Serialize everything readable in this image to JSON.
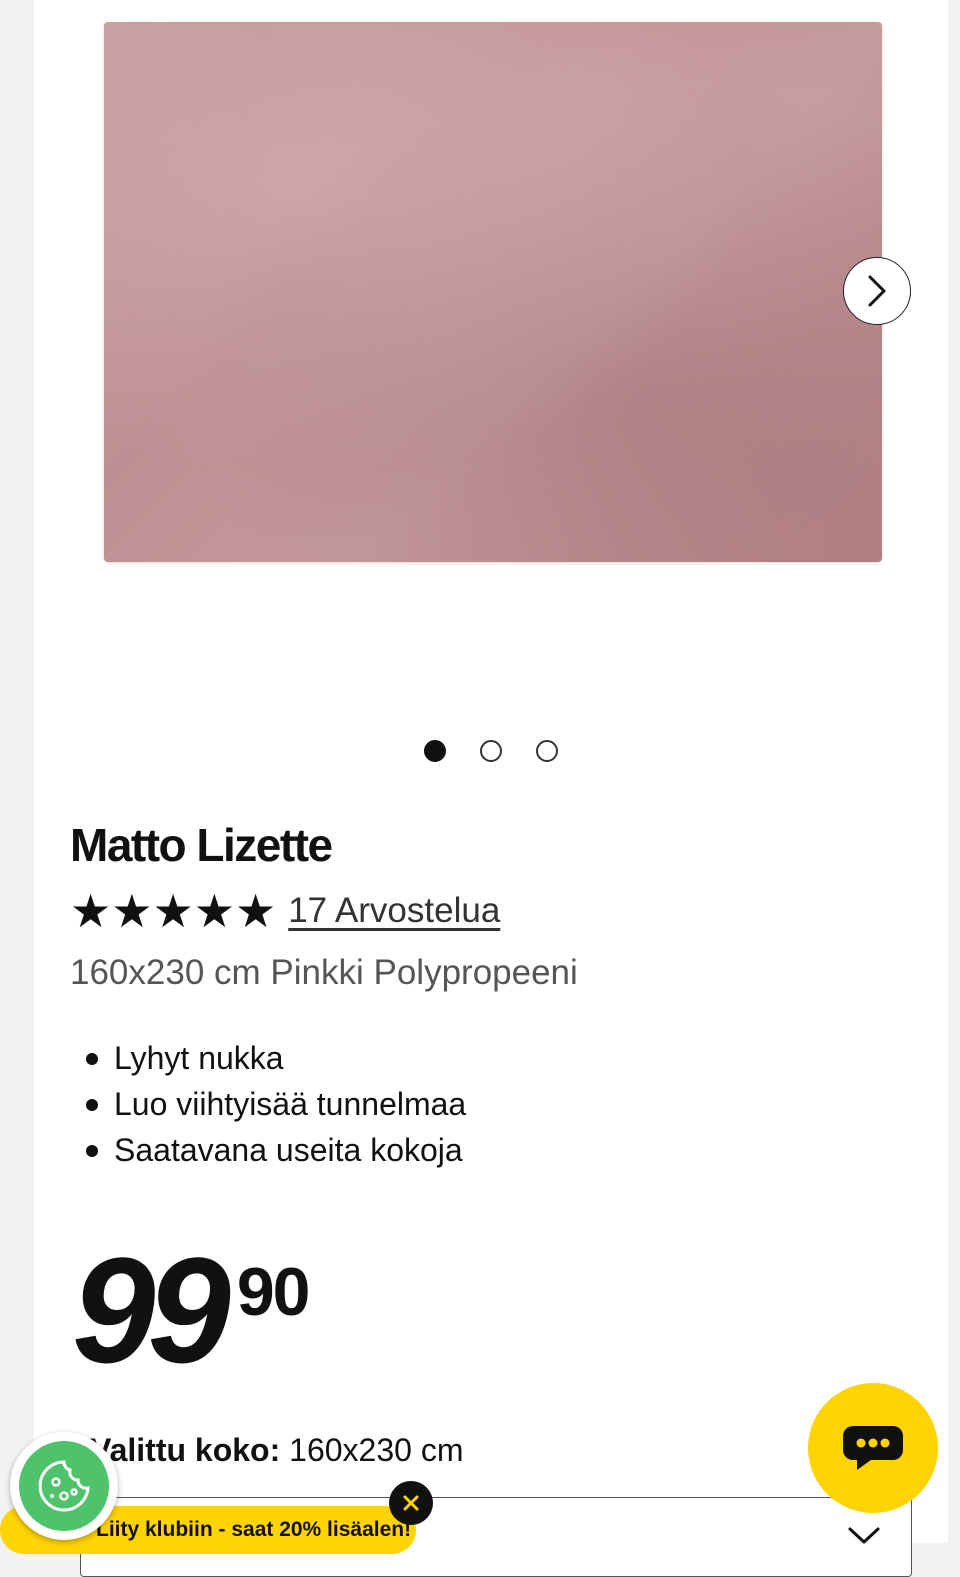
{
  "product": {
    "title": "Matto Lizette",
    "stars": "★★★★★",
    "reviews_link": "17 Arvostelua",
    "subtitle": "160x230 cm Pinkki Polypropeeni",
    "features": [
      "Lyhyt nukka",
      "Luo viihtyisää tunnelmaa",
      "Saatavana useita kokoja"
    ],
    "price_integer": "99",
    "price_decimal": "90",
    "size_label": "Valittu koko:",
    "size_value": "160x230 cm",
    "rating_value": 5,
    "rating_max": 5
  },
  "gallery": {
    "image_count": 3,
    "active_index": 0,
    "image_color": "#c1949a"
  },
  "overlays": {
    "club_banner_text": "Liity klubiin - saat 20% lisäalen!",
    "accent_color": "#ffd400",
    "cookie_color": "#4fc36b"
  },
  "icons": {
    "next": "chevron-right-icon",
    "chat": "chat-bubble-icon",
    "close": "close-icon",
    "cookie": "cookie-icon",
    "select": "chevron-down-icon"
  }
}
